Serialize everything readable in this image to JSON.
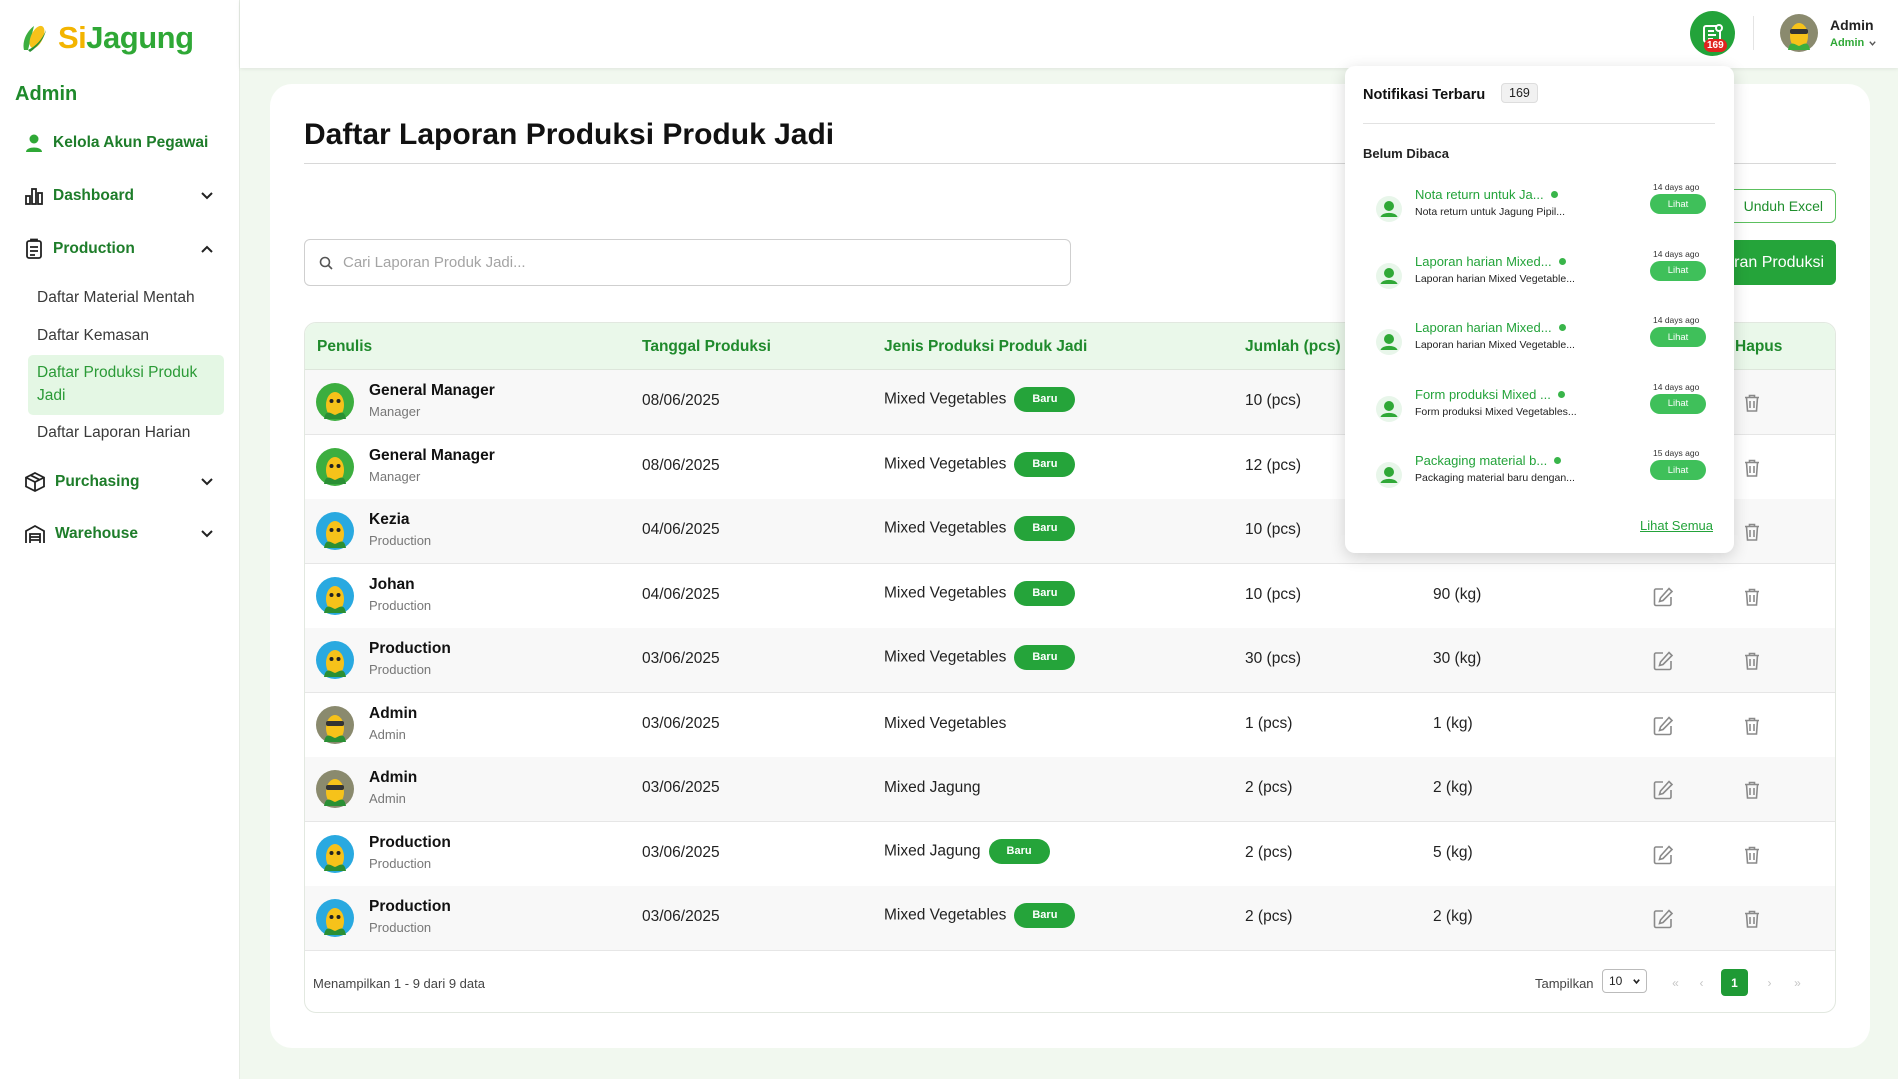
{
  "app": {
    "logo_si": "Si",
    "logo_jagung": "Jagung",
    "role": "Admin"
  },
  "sidebar": {
    "account": "Kelola Akun Pegawai",
    "dashboard": "Dashboard",
    "production": "Production",
    "production_items": [
      "Daftar Material Mentah",
      "Daftar Kemasan",
      "Daftar Produksi Produk Jadi",
      "Daftar Laporan Harian"
    ],
    "purchasing": "Purchasing",
    "warehouse": "Warehouse"
  },
  "topbar": {
    "notif_count": "169",
    "user_name": "Admin",
    "user_role": "Admin"
  },
  "page": {
    "title": "Daftar Laporan Produksi Produk Jadi",
    "search_placeholder": "Cari Laporan Produk Jadi...",
    "excel_button": "Unduh Excel",
    "add_button": "ran Produksi"
  },
  "table": {
    "headers": [
      "Penulis",
      "Tanggal Produksi",
      "Jenis Produksi Produk Jadi",
      "Jumlah (pcs)",
      "Hapus"
    ],
    "badge_label": "Baru",
    "rows": [
      {
        "name": "General Manager",
        "role": "Manager",
        "date": "08/06/2025",
        "type": "Mixed Vegetables",
        "new": true,
        "qty": "10 (pcs)",
        "weight": ""
      },
      {
        "name": "General Manager",
        "role": "Manager",
        "date": "08/06/2025",
        "type": "Mixed Vegetables",
        "new": true,
        "qty": "12 (pcs)",
        "weight": ""
      },
      {
        "name": "Kezia",
        "role": "Production",
        "date": "04/06/2025",
        "type": "Mixed Vegetables",
        "new": true,
        "qty": "10 (pcs)",
        "weight": ""
      },
      {
        "name": "Johan",
        "role": "Production",
        "date": "04/06/2025",
        "type": "Mixed Vegetables",
        "new": true,
        "qty": "10 (pcs)",
        "weight": "90 (kg)"
      },
      {
        "name": "Production",
        "role": "Production",
        "date": "03/06/2025",
        "type": "Mixed Vegetables",
        "new": true,
        "qty": "30 (pcs)",
        "weight": "30 (kg)"
      },
      {
        "name": "Admin",
        "role": "Admin",
        "date": "03/06/2025",
        "type": "Mixed Vegetables",
        "new": false,
        "qty": "1 (pcs)",
        "weight": "1 (kg)"
      },
      {
        "name": "Admin",
        "role": "Admin",
        "date": "03/06/2025",
        "type": "Mixed Jagung",
        "new": false,
        "qty": "2 (pcs)",
        "weight": "2 (kg)"
      },
      {
        "name": "Production",
        "role": "Production",
        "date": "03/06/2025",
        "type": "Mixed Jagung",
        "new": true,
        "qty": "2 (pcs)",
        "weight": "5 (kg)"
      },
      {
        "name": "Production",
        "role": "Production",
        "date": "03/06/2025",
        "type": "Mixed Vegetables",
        "new": true,
        "qty": "2 (pcs)",
        "weight": "2 (kg)"
      }
    ],
    "footer_info": "Menampilkan 1 - 9 dari 9 data",
    "footer_show": "Tampilkan",
    "page_size": "10",
    "current_page": "1",
    "pager_first": "«",
    "pager_prev": "‹",
    "pager_next": "›",
    "pager_last": "»"
  },
  "notifications": {
    "title": "Notifikasi Terbaru",
    "count": "169",
    "section": "Belum Dibaca",
    "action_label": "Lihat",
    "see_all": "Lihat Semua",
    "items": [
      {
        "title": "Nota return untuk Ja...",
        "body": "Nota return untuk Jagung Pipil...",
        "time": "14 days ago"
      },
      {
        "title": "Laporan harian Mixed...",
        "body": "Laporan harian Mixed Vegetable...",
        "time": "14 days ago"
      },
      {
        "title": "Laporan harian Mixed...",
        "body": "Laporan harian Mixed Vegetable...",
        "time": "14 days ago"
      },
      {
        "title": "Form produksi Mixed ...",
        "body": "Form produksi Mixed Vegetables...",
        "time": "14 days ago"
      },
      {
        "title": "Packaging material b...",
        "body": "Packaging material baru dengan...",
        "time": "15 days ago"
      }
    ]
  },
  "colors": {
    "brand_green": "#25a43a",
    "brand_yellow": "#f3b400",
    "header_bg": "#eaf8ea",
    "badge_red": "#e0241f"
  }
}
